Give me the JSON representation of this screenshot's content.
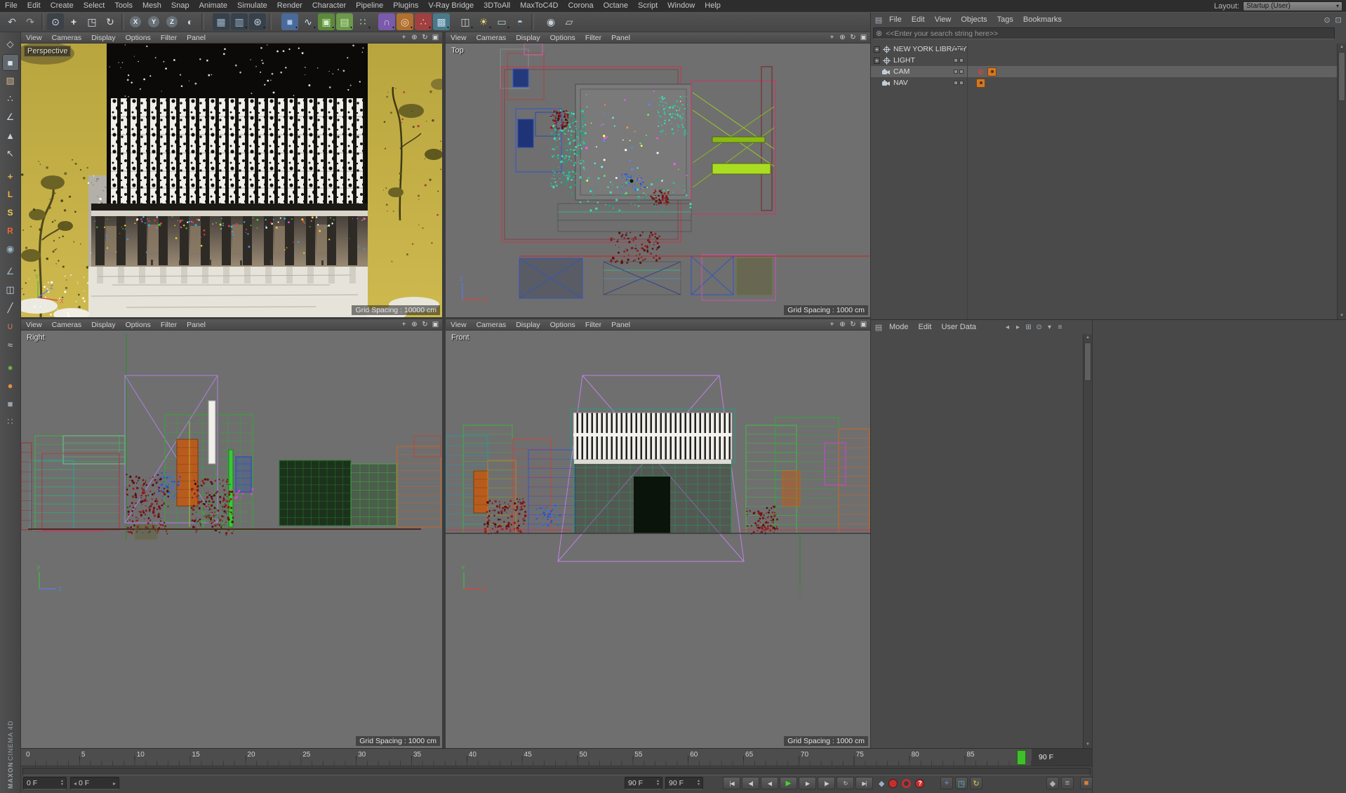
{
  "menubar": {
    "items": [
      "File",
      "Edit",
      "Create",
      "Select",
      "Tools",
      "Mesh",
      "Snap",
      "Animate",
      "Simulate",
      "Render",
      "Character",
      "Pipeline",
      "Plugins",
      "V-Ray Bridge",
      "3DToAll",
      "MaxToC4D",
      "Corona",
      "Octane",
      "Script",
      "Window",
      "Help"
    ],
    "layout_label": "Layout:",
    "layout_value": "Startup (User)"
  },
  "glyphs": {
    "caret": "▾",
    "up": "▴",
    "down": "▾",
    "left": "◂",
    "right": "▸",
    "clear": "⊗",
    "panel_menu": "▤",
    "lock": "⊡",
    "find": "⊙"
  },
  "toolbar": {
    "icons": [
      {
        "name": "undo-icon",
        "glyph": "↶",
        "fg": "#c2cdd8"
      },
      {
        "name": "redo-icon",
        "glyph": "↷",
        "fg": "#9fa8b2"
      },
      {
        "sep": true
      },
      {
        "name": "live-selection-icon",
        "glyph": "⊙",
        "fg": "#d8dde2",
        "bg": "#3c4248"
      },
      {
        "name": "move-tool-icon",
        "glyph": "+",
        "fg": "#e0e6ec",
        "bold": true
      },
      {
        "name": "scale-tool-icon",
        "glyph": "◳",
        "fg": "#d5dce2"
      },
      {
        "name": "rotate-tool-icon",
        "glyph": "↻",
        "fg": "#d5dce2"
      },
      {
        "sep": true
      },
      {
        "name": "lock-x-axis-icon",
        "glyph": "X",
        "fg": "#ececec",
        "round": true
      },
      {
        "name": "lock-y-axis-icon",
        "glyph": "Y",
        "fg": "#ececec",
        "round": true
      },
      {
        "name": "lock-z-axis-icon",
        "glyph": "Z",
        "fg": "#ececec",
        "round": true
      },
      {
        "name": "coordinate-system-icon",
        "glyph": "◐",
        "fg": "#c8d2da"
      },
      {
        "sep": true
      },
      {
        "gap": 8
      },
      {
        "name": "render-view-icon",
        "glyph": "▦",
        "fg": "#9fb6c8",
        "bg": "#37414b"
      },
      {
        "name": "render-picture-viewer-icon",
        "glyph": "▥",
        "fg": "#9fb6c8",
        "bg": "#37414b",
        "caret": true
      },
      {
        "name": "render-settings-icon",
        "glyph": "⊛",
        "fg": "#c8d2da",
        "bg": "#37414b",
        "caret": true
      },
      {
        "sep": true
      },
      {
        "gap": 10
      },
      {
        "name": "add-cube-icon",
        "glyph": "■",
        "fg": "#a8c4e8",
        "bg": "#4a6a9a",
        "caret": true
      },
      {
        "name": "add-spline-icon",
        "glyph": "∿",
        "fg": "#cfe0f0",
        "caret": true
      },
      {
        "name": "add-subdivision-icon",
        "glyph": "▣",
        "fg": "#d8ecc8",
        "bg": "#5a8a3a",
        "caret": true
      },
      {
        "name": "add-extrude-icon",
        "glyph": "▤",
        "fg": "#cde6b8",
        "bg": "#6a9a4a",
        "caret": true
      },
      {
        "name": "add-instance-icon",
        "glyph": "∷",
        "fg": "#b8d8a0",
        "caret": true
      },
      {
        "gap": 8
      },
      {
        "name": "add-deformer-icon",
        "glyph": "∩",
        "fg": "#d8c8f0",
        "bg": "#7a5aaa",
        "caret": true
      },
      {
        "name": "add-field-icon",
        "glyph": "◎",
        "fg": "#f0d8b8",
        "bg": "#b07030",
        "caret": true
      },
      {
        "name": "add-mograph-icon",
        "glyph": "∴",
        "fg": "#f0c0c0",
        "bg": "#a04040",
        "caret": true
      },
      {
        "name": "add-volume-icon",
        "glyph": "▩",
        "fg": "#c0d8e8",
        "bg": "#4a7a8a",
        "caret": true
      },
      {
        "gap": 8
      },
      {
        "name": "add-camera-icon",
        "glyph": "◫",
        "fg": "#d0d8e0",
        "caret": true
      },
      {
        "name": "add-light-icon",
        "glyph": "☀",
        "fg": "#f0dc6a",
        "caret": true
      },
      {
        "name": "add-floor-icon",
        "glyph": "▭",
        "fg": "#b8d8c8",
        "caret": true
      },
      {
        "name": "add-sky-icon",
        "glyph": "◓",
        "fg": "#a8c8e8"
      },
      {
        "sep": true
      },
      {
        "gap": 8
      },
      {
        "name": "snap-toggle-icon",
        "glyph": "◉",
        "fg": "#c8d0d8"
      },
      {
        "name": "workplane-icon",
        "glyph": "▱",
        "fg": "#c8d0d8"
      }
    ]
  },
  "side_toolbar": {
    "icons": [
      {
        "name": "make-editable-icon",
        "glyph": "◇",
        "fg": "#c8d4de"
      },
      {
        "name": "model-mode-icon",
        "glyph": "■",
        "fg": "#d8e2ea",
        "selected": true
      },
      {
        "name": "texture-mode-icon",
        "glyph": "▨",
        "fg": "#d0b890"
      },
      {
        "name": "points-mode-icon",
        "glyph": "∴",
        "fg": "#c8d4de"
      },
      {
        "name": "edges-mode-icon",
        "glyph": "∠",
        "fg": "#c8d4de"
      },
      {
        "name": "polygons-mode-icon",
        "glyph": "▲",
        "fg": "#c8d4de"
      },
      {
        "name": "tweak-mode-icon",
        "glyph": "↖",
        "fg": "#c8d4de"
      },
      {
        "gap": 6
      },
      {
        "name": "enable-axis-icon",
        "glyph": "+",
        "fg": "#e8b04a",
        "bold": true
      },
      {
        "name": "vray-lights-icon",
        "glyph": "L",
        "fg": "#f0b040",
        "letter": true
      },
      {
        "name": "vray-sun-icon",
        "glyph": "S",
        "fg": "#f0d050",
        "letter": true
      },
      {
        "name": "vray-render-icon",
        "glyph": "R",
        "fg": "#e86830",
        "letter": true
      },
      {
        "name": "snap-icon",
        "glyph": "◉",
        "fg": "#9ab4c8"
      },
      {
        "gap": 6
      },
      {
        "name": "quantize-icon",
        "glyph": "∠",
        "fg": "#9ab4c8"
      },
      {
        "name": "mirror-icon",
        "glyph": "◫",
        "fg": "#c8d4de"
      },
      {
        "name": "knife-icon",
        "glyph": "╱",
        "fg": "#c8d4de"
      },
      {
        "name": "magnet-icon",
        "glyph": "∪",
        "fg": "#c87858"
      },
      {
        "name": "smooth-icon",
        "glyph": "≈",
        "fg": "#c8d4de"
      },
      {
        "gap": 6
      },
      {
        "name": "green-sphere-icon",
        "glyph": "●",
        "fg": "#6ab04a"
      },
      {
        "name": "orange-sphere-icon",
        "glyph": "●",
        "fg": "#e09040"
      },
      {
        "name": "gray-cube-icon",
        "glyph": "■",
        "fg": "#9aa4ae"
      },
      {
        "name": "dots-icon",
        "glyph": "∷",
        "fg": "#9aa4ae"
      }
    ]
  },
  "viewport_menu": [
    "View",
    "Cameras",
    "Display",
    "Options",
    "Filter",
    "Panel"
  ],
  "viewport_corner_icons": [
    {
      "name": "pan-view-icon",
      "glyph": "+"
    },
    {
      "name": "zoom-view-icon",
      "glyph": "⊕"
    },
    {
      "name": "rotate-view-icon",
      "glyph": "↻"
    },
    {
      "name": "toggle-view-icon",
      "glyph": "▣"
    }
  ],
  "viewports": {
    "perspective": {
      "label": "Perspective",
      "grid": "Grid Spacing : 10000 cm"
    },
    "top": {
      "label": "Top",
      "grid": "Grid Spacing : 1000 cm"
    },
    "right": {
      "label": "Right",
      "grid": "Grid Spacing : 1000 cm"
    },
    "front": {
      "label": "Front",
      "grid": "Grid Spacing : 1000 cm"
    }
  },
  "axis": {
    "x": "X",
    "y": "Y",
    "z": "Z"
  },
  "object_manager": {
    "menus": [
      "File",
      "Edit",
      "View",
      "Objects",
      "Tags",
      "Bookmarks"
    ],
    "right_icons": [
      {
        "name": "find-icon",
        "glyph": "⊙"
      },
      {
        "name": "lock-icon",
        "glyph": "⊡"
      }
    ],
    "search_placeholder": "<<Enter your search string here>>",
    "objects": [
      {
        "name": "NEW YORK LIBRARY",
        "type": "null",
        "expand": "+",
        "tags": []
      },
      {
        "name": "LIGHT",
        "type": "null",
        "expand": "+",
        "tags": []
      },
      {
        "name": "CAM",
        "type": "camera",
        "selected": true,
        "tags": [
          "display-off",
          "vray-cam"
        ]
      },
      {
        "name": "NAV",
        "type": "camera",
        "tags": [
          "vray-cam"
        ]
      }
    ]
  },
  "attribute_manager": {
    "menus": [
      "Mode",
      "Edit",
      "User Data"
    ],
    "nav_icons": [
      {
        "name": "history-back-icon",
        "glyph": "◂"
      },
      {
        "name": "history-forward-icon",
        "glyph": "▸"
      }
    ],
    "icons": [
      {
        "name": "grid-icon",
        "glyph": "⊞"
      },
      {
        "name": "search-icon",
        "glyph": "⊙"
      },
      {
        "name": "filter-icon",
        "glyph": "▾"
      },
      {
        "name": "menu-icon",
        "glyph": "≡"
      }
    ]
  },
  "timeline": {
    "tick_labels": [
      "0",
      "5",
      "10",
      "15",
      "20",
      "25",
      "30",
      "35",
      "40",
      "45",
      "50",
      "55",
      "60",
      "65",
      "70",
      "75",
      "80",
      "85"
    ],
    "fields": {
      "start": "0 F",
      "range_start": "0 F",
      "end_a": "90 F",
      "end_b": "90 F",
      "current": "90 F"
    },
    "transport": [
      {
        "name": "goto-start-button",
        "sym": "|◀"
      },
      {
        "name": "previous-key-button",
        "sym": "◀|"
      },
      {
        "name": "previous-frame-button",
        "sym": "◀"
      },
      {
        "name": "play-forward-button",
        "sym": "▶",
        "accent": true
      },
      {
        "name": "next-frame-button",
        "sym": "▶"
      },
      {
        "name": "next-key-button",
        "sym": "|▶"
      },
      {
        "name": "play-cycle-button",
        "sym": "↻"
      },
      {
        "name": "goto-end-button",
        "sym": "▶|"
      }
    ],
    "key_icon": {
      "name": "set-keyframe-button",
      "glyph": "◆"
    },
    "records": [
      {
        "name": "record-keyframe-button",
        "kind": "solid"
      },
      {
        "name": "autokeying-button",
        "kind": "ring"
      },
      {
        "name": "record-help-button",
        "kind": "solid",
        "glyph": "?"
      }
    ],
    "toggles": [
      {
        "name": "record-position-toggle",
        "glyph": "+",
        "fg": "#6a9ae0"
      },
      {
        "name": "record-scale-toggle",
        "glyph": "◳",
        "fg": "#5ac0d8"
      },
      {
        "name": "record-rotation-toggle",
        "glyph": "↻",
        "fg": "#d8c84a"
      },
      {
        "gap": 88
      },
      {
        "name": "solo-toggle",
        "glyph": "◆",
        "fg": "#b0b0b0"
      },
      {
        "name": "render-lock-toggle",
        "glyph": "≡",
        "fg": "#b0b0b0"
      },
      {
        "gap": 6
      },
      {
        "name": "material-slot-icon",
        "glyph": "■",
        "fg": "#e08030"
      }
    ]
  },
  "branding": {
    "line1": "MAXON",
    "line2": "CINEMA 4D"
  }
}
